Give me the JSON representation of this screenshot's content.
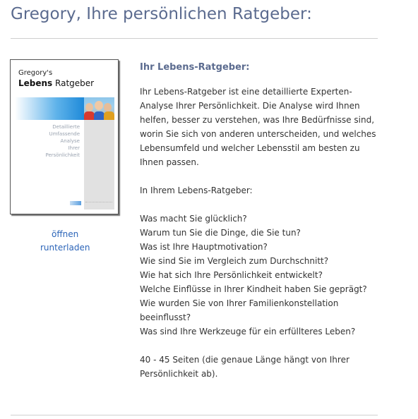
{
  "page": {
    "title": "Gregory, Ihre persönlichen Ratgeber:"
  },
  "book": {
    "cover_subtitle": "Gregory's",
    "cover_title_bold": "Lebens",
    "cover_title_rest": " Ratgeber",
    "cover_lines": [
      "Detaillierte",
      "Umfassende",
      "Analyse",
      "Ihrer",
      "Persönlichkeit"
    ],
    "open_link": "öffnen",
    "download_link": "runterladen"
  },
  "content": {
    "heading": "Ihr Lebens-Ratgeber:",
    "intro": "Ihr Lebens-Ratgeber ist eine detaillierte Experten-Analyse Ihrer Persönlichkeit. Die Analyse wird Ihnen helfen, besser zu verstehen, was Ihre Bedürfnisse sind, worin Sie sich von anderen unterscheiden, und welches Lebensumfeld und welcher Lebensstil am besten zu Ihnen passen.",
    "list_intro": "In Ihrem Lebens-Ratgeber:",
    "questions": [
      "Was macht Sie glücklich?",
      "Warum tun Sie die Dinge, die Sie tun?",
      "Was ist Ihre Hauptmotivation?",
      "Wie sind Sie im Vergleich zum Durchschnitt?",
      "Wie hat sich Ihre Persönlichkeit entwickelt?",
      "Welche Einflüsse in Ihrer Kindheit haben Sie geprägt?",
      "Wie wurden Sie von Ihrer Familienkonstellation beeinflusst?",
      "Was sind Ihre Werkzeuge für ein erfüllteres Leben?"
    ],
    "pages_note": "40 - 45 Seiten (die genaue Länge hängt von Ihrer Persönlichkeit ab)."
  },
  "colors": {
    "title": "#5b6b8f",
    "link": "#2b64b8",
    "text": "#333333",
    "rule": "#cfcfcf"
  }
}
